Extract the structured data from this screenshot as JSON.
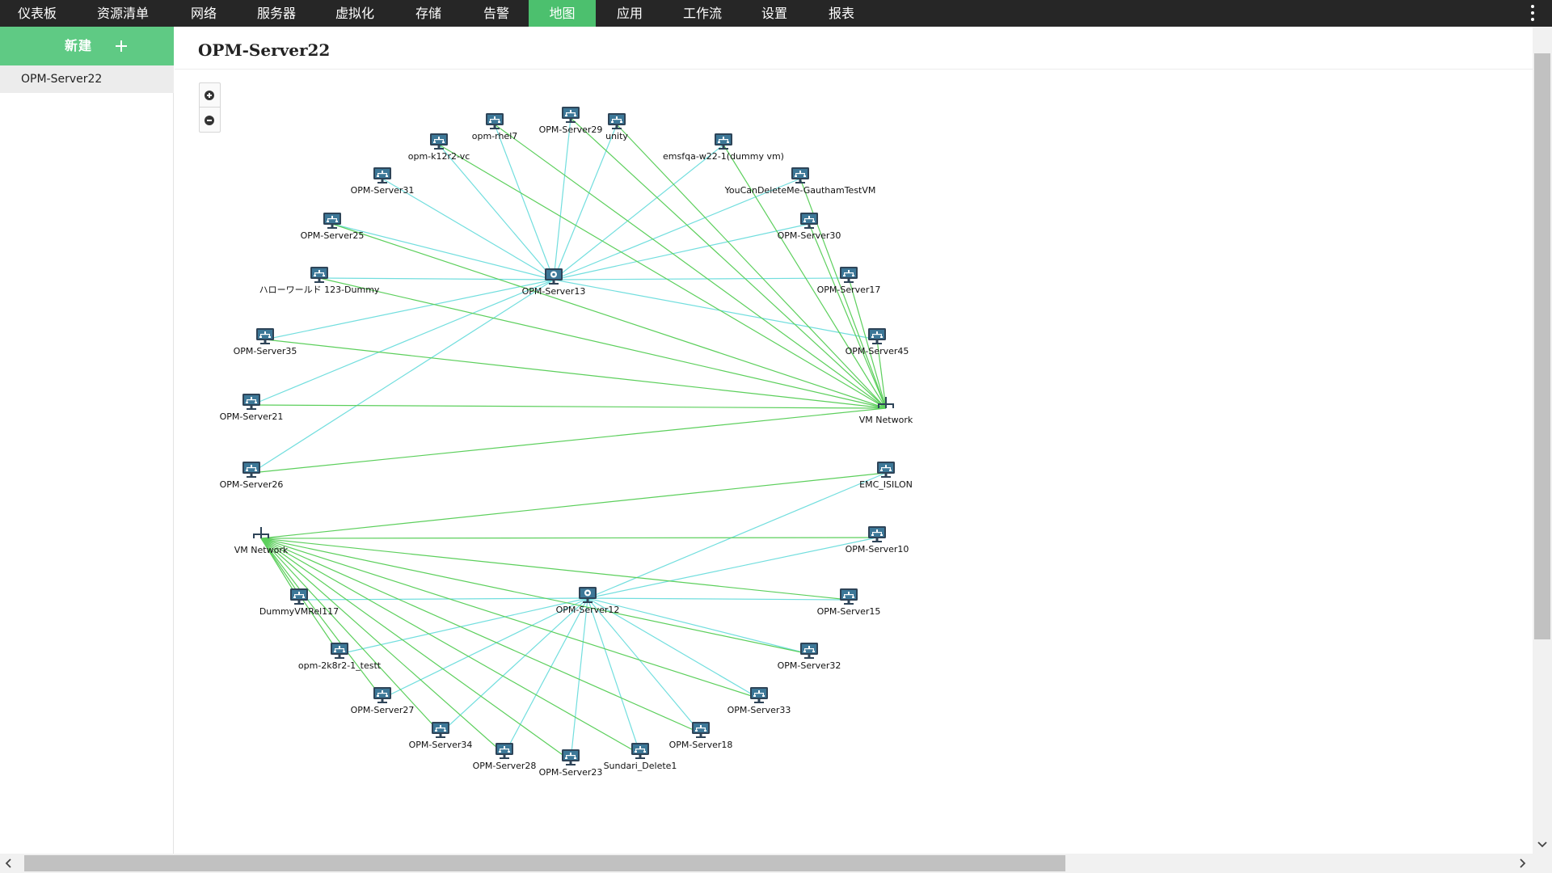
{
  "nav": {
    "tabs": [
      {
        "label": "仪表板",
        "active": false
      },
      {
        "label": "资源清单",
        "active": false
      },
      {
        "label": "网络",
        "active": false
      },
      {
        "label": "服务器",
        "active": false
      },
      {
        "label": "虚拟化",
        "active": false
      },
      {
        "label": "存储",
        "active": false
      },
      {
        "label": "告警",
        "active": false
      },
      {
        "label": "地图",
        "active": true
      },
      {
        "label": "应用",
        "active": false
      },
      {
        "label": "工作流",
        "active": false
      },
      {
        "label": "设置",
        "active": false
      },
      {
        "label": "报表",
        "active": false
      }
    ],
    "active_color": "#4cc06e",
    "bar_color": "#262626"
  },
  "sidebar": {
    "new_button_label": "新建",
    "items": [
      {
        "label": "OPM-Server22"
      }
    ]
  },
  "page": {
    "title": "OPM-Server22"
  },
  "map": {
    "link_colors": {
      "host_to_vm": "#72dede",
      "vm_to_network": "#5ccf5c"
    },
    "nodes": [
      {
        "id": "opm-rhel7",
        "label": "opm-rhel7",
        "kind": "vm"
      },
      {
        "id": "opm-server29",
        "label": "OPM-Server29",
        "kind": "vm"
      },
      {
        "id": "unity",
        "label": "unity",
        "kind": "vm"
      },
      {
        "id": "opm-k12r2-vc",
        "label": "opm-k12r2-vc",
        "kind": "vm"
      },
      {
        "id": "emsfqa-w22-1",
        "label": "emsfqa-w22-1(dummy vm)",
        "kind": "vm"
      },
      {
        "id": "opm-server31",
        "label": "OPM-Server31",
        "kind": "vm"
      },
      {
        "id": "youcandeleteme",
        "label": "YouCanDeleteMe-GauthamTestVM",
        "kind": "vm"
      },
      {
        "id": "opm-server25",
        "label": "OPM-Server25",
        "kind": "vm"
      },
      {
        "id": "opm-server30",
        "label": "OPM-Server30",
        "kind": "vm"
      },
      {
        "id": "hello-world",
        "label": "ハローワールド 123-Dummy",
        "kind": "vm"
      },
      {
        "id": "opm-server13",
        "label": "OPM-Server13",
        "kind": "host"
      },
      {
        "id": "opm-server17",
        "label": "OPM-Server17",
        "kind": "vm"
      },
      {
        "id": "opm-server35",
        "label": "OPM-Server35",
        "kind": "vm"
      },
      {
        "id": "opm-server45",
        "label": "OPM-Server45",
        "kind": "vm"
      },
      {
        "id": "opm-server21",
        "label": "OPM-Server21",
        "kind": "vm"
      },
      {
        "id": "vm-network-right",
        "label": "VM Network",
        "kind": "network"
      },
      {
        "id": "opm-server26",
        "label": "OPM-Server26",
        "kind": "vm"
      },
      {
        "id": "emc-isilon",
        "label": "EMC_ISILON",
        "kind": "vm"
      },
      {
        "id": "vm-network-left",
        "label": "VM Network",
        "kind": "network"
      },
      {
        "id": "opm-server10",
        "label": "OPM-Server10",
        "kind": "vm"
      },
      {
        "id": "opm-server12",
        "label": "OPM-Server12",
        "kind": "host"
      },
      {
        "id": "dummyvmrel117",
        "label": "DummyVMRel117",
        "kind": "vm"
      },
      {
        "id": "opm-server15",
        "label": "OPM-Server15",
        "kind": "vm"
      },
      {
        "id": "opm-2k8r2-1-testt",
        "label": "opm-2k8r2-1_testt",
        "kind": "vm"
      },
      {
        "id": "opm-server32",
        "label": "OPM-Server32",
        "kind": "vm"
      },
      {
        "id": "opm-server27",
        "label": "OPM-Server27",
        "kind": "vm"
      },
      {
        "id": "opm-server33",
        "label": "OPM-Server33",
        "kind": "vm"
      },
      {
        "id": "opm-server34",
        "label": "OPM-Server34",
        "kind": "vm"
      },
      {
        "id": "opm-server18",
        "label": "OPM-Server18",
        "kind": "vm"
      },
      {
        "id": "opm-server28",
        "label": "OPM-Server28",
        "kind": "vm"
      },
      {
        "id": "sundari-delete1",
        "label": "Sundari_Delete1",
        "kind": "vm"
      },
      {
        "id": "opm-server23",
        "label": "OPM-Server23",
        "kind": "vm"
      }
    ],
    "links": [
      {
        "from": "opm-server13",
        "to": "opm-rhel7",
        "type": "host_to_vm"
      },
      {
        "from": "opm-server13",
        "to": "opm-server29",
        "type": "host_to_vm"
      },
      {
        "from": "opm-server13",
        "to": "unity",
        "type": "host_to_vm"
      },
      {
        "from": "opm-server13",
        "to": "opm-k12r2-vc",
        "type": "host_to_vm"
      },
      {
        "from": "opm-server13",
        "to": "emsfqa-w22-1",
        "type": "host_to_vm"
      },
      {
        "from": "opm-server13",
        "to": "opm-server31",
        "type": "host_to_vm"
      },
      {
        "from": "opm-server13",
        "to": "youcandeleteme",
        "type": "host_to_vm"
      },
      {
        "from": "opm-server13",
        "to": "opm-server25",
        "type": "host_to_vm"
      },
      {
        "from": "opm-server13",
        "to": "opm-server30",
        "type": "host_to_vm"
      },
      {
        "from": "opm-server13",
        "to": "hello-world",
        "type": "host_to_vm"
      },
      {
        "from": "opm-server13",
        "to": "opm-server17",
        "type": "host_to_vm"
      },
      {
        "from": "opm-server13",
        "to": "opm-server35",
        "type": "host_to_vm"
      },
      {
        "from": "opm-server13",
        "to": "opm-server45",
        "type": "host_to_vm"
      },
      {
        "from": "opm-server13",
        "to": "opm-server21",
        "type": "host_to_vm"
      },
      {
        "from": "opm-server13",
        "to": "opm-server26",
        "type": "host_to_vm"
      },
      {
        "from": "vm-network-right",
        "to": "opm-rhel7",
        "type": "vm_to_network"
      },
      {
        "from": "vm-network-right",
        "to": "opm-server29",
        "type": "vm_to_network"
      },
      {
        "from": "vm-network-right",
        "to": "unity",
        "type": "vm_to_network"
      },
      {
        "from": "vm-network-right",
        "to": "opm-k12r2-vc",
        "type": "vm_to_network"
      },
      {
        "from": "vm-network-right",
        "to": "emsfqa-w22-1",
        "type": "vm_to_network"
      },
      {
        "from": "vm-network-right",
        "to": "youcandeleteme",
        "type": "vm_to_network"
      },
      {
        "from": "vm-network-right",
        "to": "opm-server25",
        "type": "vm_to_network"
      },
      {
        "from": "vm-network-right",
        "to": "opm-server30",
        "type": "vm_to_network"
      },
      {
        "from": "vm-network-right",
        "to": "hello-world",
        "type": "vm_to_network"
      },
      {
        "from": "vm-network-right",
        "to": "opm-server17",
        "type": "vm_to_network"
      },
      {
        "from": "vm-network-right",
        "to": "opm-server35",
        "type": "vm_to_network"
      },
      {
        "from": "vm-network-right",
        "to": "opm-server45",
        "type": "vm_to_network"
      },
      {
        "from": "vm-network-right",
        "to": "opm-server21",
        "type": "vm_to_network"
      },
      {
        "from": "vm-network-right",
        "to": "opm-server26",
        "type": "vm_to_network"
      },
      {
        "from": "opm-server12",
        "to": "emc-isilon",
        "type": "host_to_vm"
      },
      {
        "from": "opm-server12",
        "to": "opm-server10",
        "type": "host_to_vm"
      },
      {
        "from": "opm-server12",
        "to": "dummyvmrel117",
        "type": "host_to_vm"
      },
      {
        "from": "opm-server12",
        "to": "opm-server15",
        "type": "host_to_vm"
      },
      {
        "from": "opm-server12",
        "to": "opm-2k8r2-1-testt",
        "type": "host_to_vm"
      },
      {
        "from": "opm-server12",
        "to": "opm-server32",
        "type": "host_to_vm"
      },
      {
        "from": "opm-server12",
        "to": "opm-server27",
        "type": "host_to_vm"
      },
      {
        "from": "opm-server12",
        "to": "opm-server33",
        "type": "host_to_vm"
      },
      {
        "from": "opm-server12",
        "to": "opm-server34",
        "type": "host_to_vm"
      },
      {
        "from": "opm-server12",
        "to": "opm-server18",
        "type": "host_to_vm"
      },
      {
        "from": "opm-server12",
        "to": "opm-server28",
        "type": "host_to_vm"
      },
      {
        "from": "opm-server12",
        "to": "sundari-delete1",
        "type": "host_to_vm"
      },
      {
        "from": "opm-server12",
        "to": "opm-server23",
        "type": "host_to_vm"
      },
      {
        "from": "vm-network-left",
        "to": "emc-isilon",
        "type": "vm_to_network"
      },
      {
        "from": "vm-network-left",
        "to": "opm-server10",
        "type": "vm_to_network"
      },
      {
        "from": "vm-network-left",
        "to": "dummyvmrel117",
        "type": "vm_to_network"
      },
      {
        "from": "vm-network-left",
        "to": "opm-server15",
        "type": "vm_to_network"
      },
      {
        "from": "vm-network-left",
        "to": "opm-2k8r2-1-testt",
        "type": "vm_to_network"
      },
      {
        "from": "vm-network-left",
        "to": "opm-server32",
        "type": "vm_to_network"
      },
      {
        "from": "vm-network-left",
        "to": "opm-server27",
        "type": "vm_to_network"
      },
      {
        "from": "vm-network-left",
        "to": "opm-server33",
        "type": "vm_to_network"
      },
      {
        "from": "vm-network-left",
        "to": "opm-server34",
        "type": "vm_to_network"
      },
      {
        "from": "vm-network-left",
        "to": "opm-server18",
        "type": "vm_to_network"
      },
      {
        "from": "vm-network-left",
        "to": "opm-server28",
        "type": "vm_to_network"
      },
      {
        "from": "vm-network-left",
        "to": "sundari-delete1",
        "type": "vm_to_network"
      },
      {
        "from": "vm-network-left",
        "to": "opm-server23",
        "type": "vm_to_network"
      }
    ]
  }
}
